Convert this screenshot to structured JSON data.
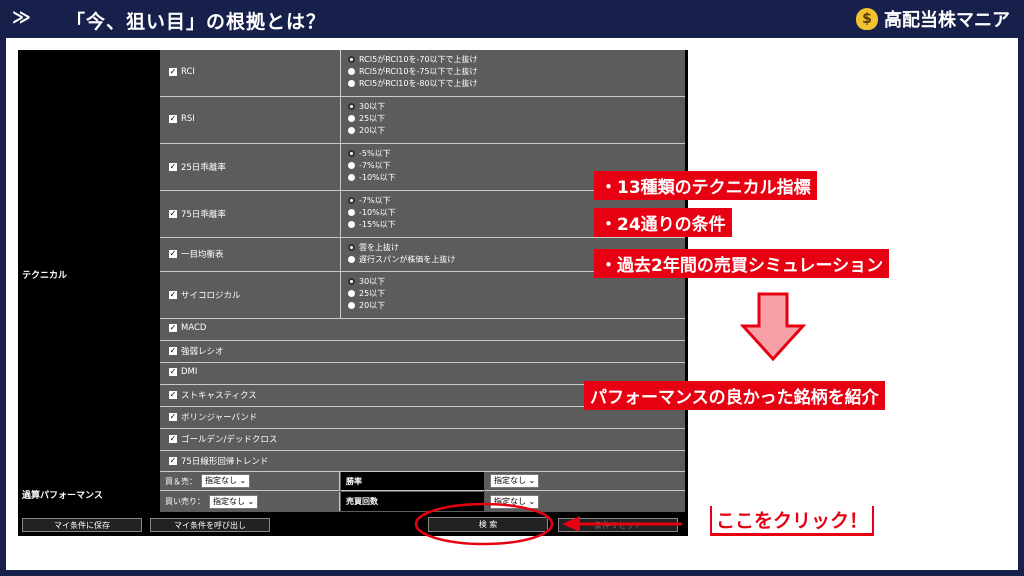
{
  "header": {
    "chevron": "≫",
    "title": "「今、狙い目」の根拠とは？",
    "brand_icon": "$",
    "brand_name": "高配当株マニア"
  },
  "form": {
    "left_titles": {
      "technical": "テクニカル",
      "performance": "過算パフォーマンス"
    },
    "indicators": [
      {
        "label": "RCI",
        "options": [
          "RCI5がRCI10を-70以下で上抜け",
          "RCI5がRCI10を-75以下で上抜け",
          "RCI5がRCI10を-80以下で上抜け"
        ]
      },
      {
        "label": "RSI",
        "options": [
          "30以下",
          "25以下",
          "20以下"
        ]
      },
      {
        "label": "25日乖離率",
        "options": [
          "-5%以下",
          "-7%以下",
          "-10%以下"
        ]
      },
      {
        "label": "75日乖離率",
        "options": [
          "-7%以下",
          "-10%以下",
          "-15%以下"
        ]
      },
      {
        "label": "一目均衡表",
        "options": [
          "雲を上抜け",
          "遅行スパンが株価を上抜け"
        ]
      },
      {
        "label": "サイコロジカル",
        "options": [
          "30以下",
          "25以下",
          "20以下"
        ]
      },
      {
        "label": "MACD",
        "options": []
      },
      {
        "label": "強弱レシオ",
        "options": []
      },
      {
        "label": "DMI",
        "options": []
      },
      {
        "label": "ストキャスティクス",
        "options": []
      },
      {
        "label": "ボリンジャーバンド",
        "options": []
      },
      {
        "label": "ゴールデン/デッドクロス",
        "options": []
      },
      {
        "label": "75日線形回帰トレンド",
        "options": []
      }
    ],
    "performance": {
      "buy_sell_label": "買＆売：",
      "buy_sell_value": "指定なし ⌄",
      "buy_label": "買い売り：",
      "buy_value": "指定なし ⌄",
      "win_rate_label": "勝率",
      "win_rate_value": "指定なし ⌄",
      "trade_count_label": "売買回数",
      "trade_count_value": "指定なし ⌄"
    },
    "buttons": {
      "save": "マイ条件に保存",
      "load": "マイ条件を呼び出し",
      "search": "検 索",
      "reset": "条件リセット"
    }
  },
  "annotations": {
    "bullets": [
      "・13種類のテクニカル指標",
      "・24通りの条件",
      "・過去2年間の売買シミュレーション"
    ],
    "result": "パフォーマンスの良かった銘柄を紹介",
    "click": "ここをクリック！"
  },
  "colors": {
    "accent_red": "#e60012",
    "header_navy": "#17204a",
    "form_gray": "#5c5c5c"
  }
}
